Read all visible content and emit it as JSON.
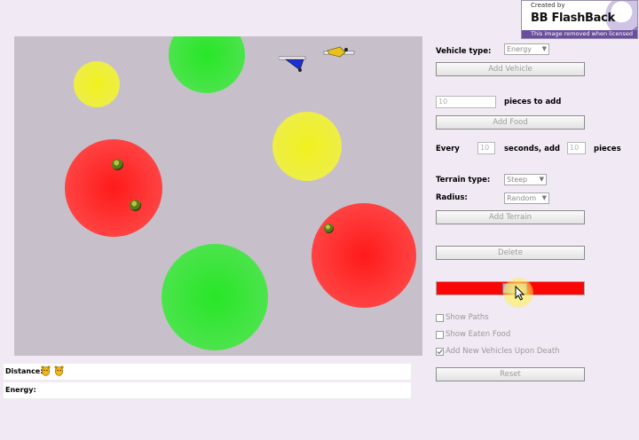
{
  "watermark": {
    "created_by": "Created by",
    "brand": "BB FlashBack",
    "notice": "This image removed when licensed"
  },
  "colors": {
    "accent_red": "#fb0606",
    "terrain_green": "#27e627",
    "terrain_yellow": "#f1f11f",
    "terrain_red": "#ff1a1a",
    "world_background": "#c7c0ca"
  },
  "controls": {
    "vehicle_type_label": "Vehicle type:",
    "vehicle_type_value": "Energy",
    "add_vehicle": "Add Vehicle",
    "pieces_value": "10",
    "pieces_label": "pieces to add",
    "add_food": "Add Food",
    "every_label": "Every",
    "every_value": "10",
    "seconds_label": "seconds, add",
    "auto_pieces_value": "10",
    "auto_pieces_label": "pieces",
    "terrain_type_label": "Terrain type:",
    "terrain_type_value": "Steep",
    "radius_label": "Radius:",
    "radius_value": "Random",
    "add_terrain": "Add Terrain",
    "delete": "Delete",
    "color_slider_level": 0.55,
    "show_paths": "Show Paths",
    "show_eaten_food": "Show Eaten Food",
    "add_new_vehicles": "Add New Vehicles Upon Death",
    "add_new_vehicles_checked": true,
    "reset": "Reset"
  },
  "info": {
    "distance_label": "Distance:",
    "energy_label": "Energy:",
    "distance_icons": [
      "bear-icon",
      "bear-icon"
    ]
  }
}
